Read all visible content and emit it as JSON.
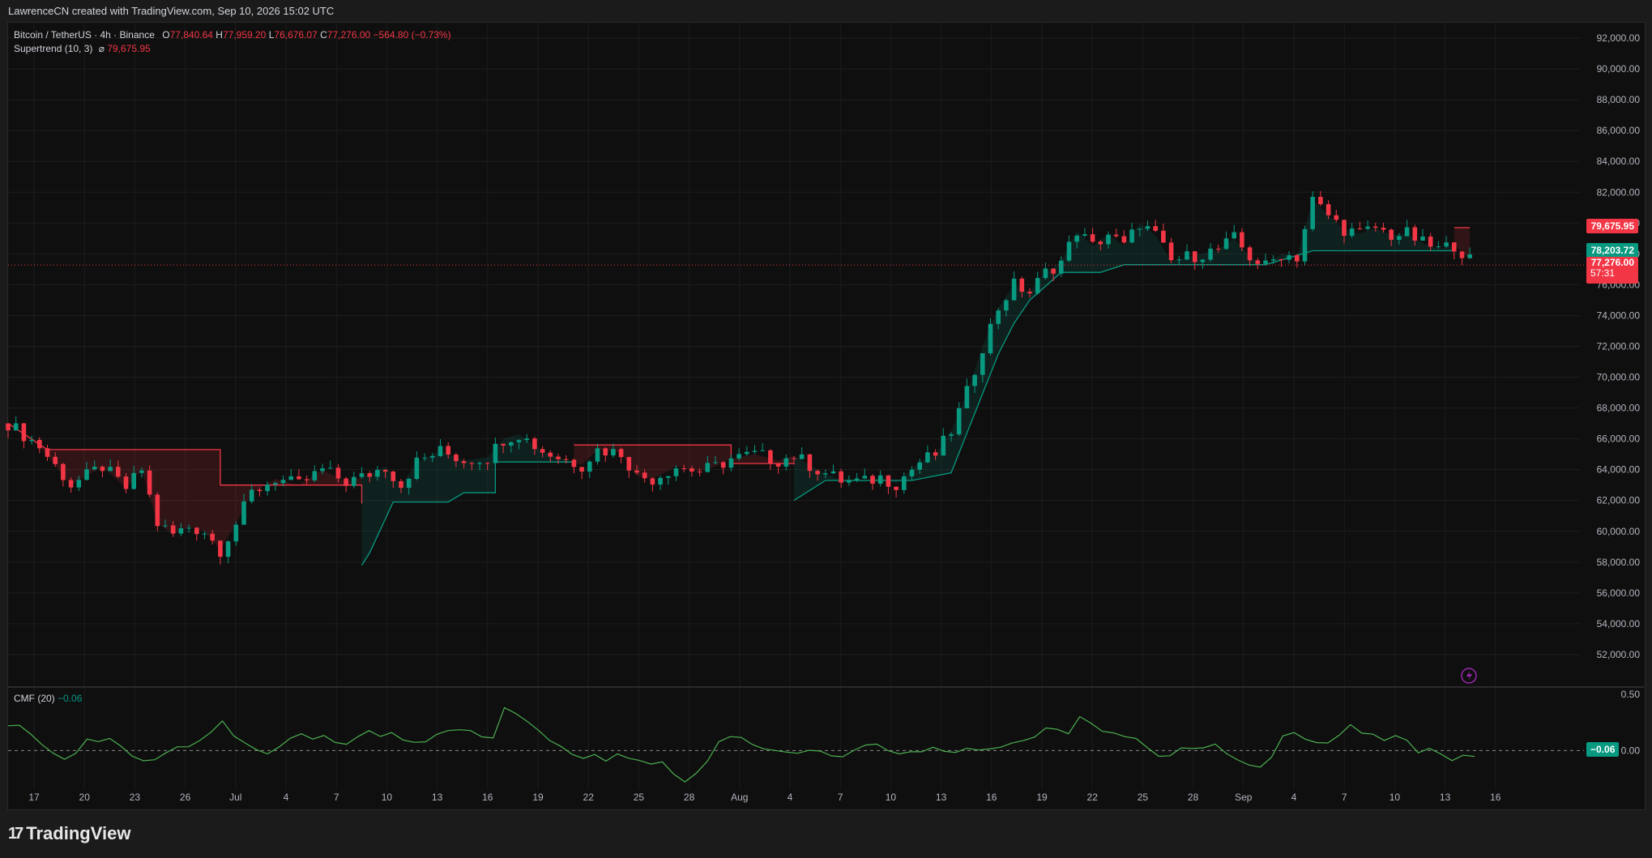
{
  "header": {
    "attribution": "LawrenceCN created with TradingView.com, Sep 10, 2026 15:02 UTC"
  },
  "legend": {
    "symbol": "Bitcoin / TetherUS · 4h · Binance",
    "open_key": "O",
    "open": "77,840.64",
    "high_key": "H",
    "high": "77,959.20",
    "low_key": "L",
    "low": "76,676.07",
    "close_key": "C",
    "close": "77,276.00",
    "change": "−564.80 (−0.73%)",
    "indicator": "Supertrend (10, 3)",
    "indicator_sym": "⌀",
    "indicator_value": "79,675.95"
  },
  "cmf_legend": {
    "name": "CMF (20)",
    "value": "−0.06"
  },
  "price_labels": {
    "supertrend_red": "79,675.95",
    "supertrend_green": "78,203.72",
    "last_price": "77,276.00",
    "countdown": "57:31",
    "cmf_value": "−0.06"
  },
  "brand": {
    "name": "TradingView",
    "mark": "17"
  },
  "colors": {
    "up": "#089981",
    "down": "#f23645",
    "cmf": "#4caf50",
    "bg": "#0f0f0f"
  },
  "chart_data": {
    "type": "candlestick",
    "title": "Bitcoin / TetherUS · 4h · Binance",
    "y_ticks": [
      "92,000.00",
      "90,000.00",
      "88,000.00",
      "86,000.00",
      "84,000.00",
      "82,000.00",
      "80,000.00",
      "78,000.00",
      "76,000.00",
      "74,000.00",
      "72,000.00",
      "70,000.00",
      "68,000.00",
      "66,000.00",
      "64,000.00",
      "62,000.00",
      "60,000.00",
      "58,000.00",
      "56,000.00",
      "54,000.00",
      "52,000.00"
    ],
    "ylim": [
      50000,
      93000
    ],
    "x_ticks": [
      "17",
      "20",
      "23",
      "26",
      "Jul",
      "4",
      "7",
      "10",
      "13",
      "16",
      "19",
      "22",
      "25",
      "28",
      "Aug",
      "4",
      "7",
      "10",
      "13",
      "16",
      "19",
      "22",
      "25",
      "28",
      "Sep",
      "4",
      "7",
      "10",
      "13",
      "16"
    ],
    "cmf_ticks": [
      "0.50",
      "0.00"
    ],
    "cmf_ylim": [
      -0.35,
      0.55
    ],
    "price_path": [
      [
        0,
        67000
      ],
      [
        4,
        65500
      ],
      [
        8,
        63000
      ],
      [
        12,
        64200
      ],
      [
        15,
        62800
      ],
      [
        17,
        64000
      ],
      [
        19,
        60500
      ],
      [
        21,
        59800
      ],
      [
        23,
        60300
      ],
      [
        25,
        60000
      ],
      [
        27,
        58800
      ],
      [
        29,
        60500
      ],
      [
        31,
        62500
      ],
      [
        34,
        63400
      ],
      [
        37,
        63000
      ],
      [
        40,
        64000
      ],
      [
        43,
        63200
      ],
      [
        45,
        63500
      ],
      [
        48,
        64200
      ],
      [
        50,
        63000
      ],
      [
        52,
        64500
      ],
      [
        55,
        65200
      ],
      [
        58,
        64600
      ],
      [
        61,
        64800
      ],
      [
        63,
        66000
      ],
      [
        65,
        66300
      ],
      [
        68,
        65200
      ],
      [
        70,
        64800
      ],
      [
        73,
        64300
      ],
      [
        75,
        65300
      ],
      [
        78,
        65100
      ],
      [
        80,
        63600
      ],
      [
        82,
        63400
      ],
      [
        85,
        64200
      ],
      [
        88,
        63900
      ],
      [
        90,
        64200
      ],
      [
        92,
        64700
      ],
      [
        95,
        65000
      ],
      [
        98,
        64600
      ],
      [
        100,
        64900
      ],
      [
        103,
        64000
      ],
      [
        106,
        63300
      ],
      [
        109,
        63200
      ],
      [
        111,
        63500
      ],
      [
        113,
        63100
      ],
      [
        116,
        64500
      ],
      [
        118,
        65000
      ],
      [
        120,
        66500
      ],
      [
        122,
        69000
      ],
      [
        124,
        72000
      ],
      [
        126,
        74500
      ],
      [
        128,
        76000
      ],
      [
        130,
        75500
      ],
      [
        132,
        76800
      ],
      [
        134,
        77500
      ],
      [
        136,
        79500
      ],
      [
        138,
        78500
      ],
      [
        140,
        79300
      ],
      [
        142,
        78500
      ],
      [
        144,
        80000
      ],
      [
        146,
        79200
      ],
      [
        148,
        77500
      ],
      [
        150,
        77800
      ],
      [
        152,
        78000
      ],
      [
        154,
        78300
      ],
      [
        156,
        79000
      ],
      [
        158,
        77800
      ],
      [
        160,
        77200
      ],
      [
        162,
        78000
      ],
      [
        164,
        77800
      ],
      [
        166,
        81500
      ],
      [
        168,
        80500
      ],
      [
        170,
        79600
      ],
      [
        172,
        79300
      ],
      [
        174,
        79700
      ],
      [
        176,
        79200
      ],
      [
        178,
        79300
      ],
      [
        180,
        78700
      ],
      [
        182,
        78300
      ],
      [
        184,
        78600
      ],
      [
        186,
        77600
      ]
    ],
    "supertrend": [
      {
        "dir": "down",
        "pts": [
          [
            0,
            67000
          ],
          [
            5,
            65300
          ],
          [
            27,
            65300
          ],
          [
            27,
            63000
          ],
          [
            45,
            63000
          ],
          [
            45,
            61800
          ]
        ]
      },
      {
        "dir": "up",
        "pts": [
          [
            45,
            57800
          ],
          [
            46,
            58600
          ],
          [
            49,
            61900
          ],
          [
            56,
            61900
          ],
          [
            58,
            62500
          ],
          [
            62,
            62500
          ],
          [
            62,
            64500
          ],
          [
            72,
            64500
          ]
        ]
      },
      {
        "dir": "down",
        "pts": [
          [
            72,
            65600
          ],
          [
            92,
            65600
          ],
          [
            92,
            64400
          ],
          [
            100,
            64400
          ]
        ]
      },
      {
        "dir": "up",
        "pts": [
          [
            100,
            62000
          ],
          [
            104,
            63300
          ],
          [
            115,
            63300
          ],
          [
            120,
            63800
          ],
          [
            126,
            71500
          ],
          [
            128,
            73500
          ],
          [
            130,
            75000
          ],
          [
            134,
            76800
          ],
          [
            139,
            76800
          ],
          [
            142,
            77300
          ],
          [
            160,
            77300
          ],
          [
            166,
            78200
          ],
          [
            184,
            78200
          ]
        ]
      },
      {
        "dir": "down",
        "pts": [
          [
            184,
            79700
          ],
          [
            186,
            79700
          ]
        ]
      }
    ],
    "cmf": [
      0.22,
      0.2,
      0.12,
      0.05,
      0.0,
      -0.05,
      -0.02,
      0.08,
      0.05,
      0.1,
      0.06,
      -0.02,
      -0.08,
      -0.1,
      -0.05,
      0.02,
      0.05,
      0.12,
      0.18,
      0.25,
      0.1,
      0.05,
      0.02,
      0.0,
      0.05,
      0.1,
      0.12,
      0.08,
      0.14,
      0.1,
      0.08,
      0.12,
      0.15,
      0.1,
      0.16,
      0.12,
      0.1,
      0.08,
      0.12,
      0.15,
      0.18,
      0.2,
      0.15,
      0.12,
      0.36,
      0.3,
      0.25,
      0.2,
      0.12,
      0.05,
      -0.05,
      -0.1,
      -0.05,
      -0.08,
      0.0,
      -0.05,
      -0.1,
      -0.15,
      -0.12,
      -0.2,
      -0.25,
      -0.18,
      -0.1,
      0.05,
      0.1,
      0.12,
      0.08,
      0.04,
      0.0,
      -0.04,
      -0.05,
      0.0,
      0.02,
      -0.02,
      -0.05,
      -0.02,
      0.02,
      0.05,
      0.02,
      0.0,
      0.0,
      -0.03,
      0.0,
      -0.02,
      0.0,
      0.05,
      0.02,
      0.0,
      0.0,
      0.05,
      0.1,
      0.15,
      0.22,
      0.18,
      0.12,
      0.28,
      0.25,
      0.2,
      0.18,
      0.12,
      0.08,
      0.0,
      -0.05,
      -0.02,
      0.05,
      0.02,
      0.0,
      0.03,
      -0.03,
      -0.06,
      -0.1,
      -0.14,
      -0.08,
      0.1,
      0.15,
      0.12,
      0.1,
      0.08,
      0.12,
      0.2,
      0.14,
      0.16,
      0.12,
      0.15,
      0.08,
      -0.05,
      0.0,
      -0.02,
      -0.06,
      -0.02,
      -0.06
    ]
  }
}
